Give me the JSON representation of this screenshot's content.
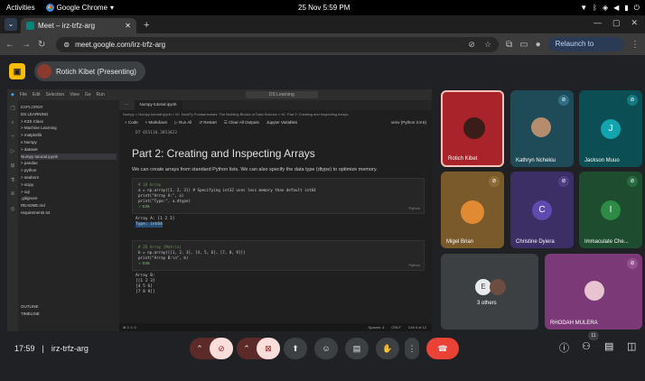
{
  "system": {
    "activities": "Activities",
    "app": "Google Chrome",
    "app_arrow": "▾",
    "datetime": "25 Nov  5:59 PM"
  },
  "browser": {
    "tab_title": "Meet – irz-trfz-arg",
    "tab_close": "✕",
    "new_tab": "+",
    "url": "meet.google.com/irz-trfz-arg",
    "relaunch": "Relaunch to update"
  },
  "meet": {
    "presenter": "Rotich Kibet (Presenting)",
    "call_time": "17:59",
    "separator": "|",
    "meeting_code": "irz-trfz-arg",
    "participant_count": "11",
    "tiles": [
      {
        "name": "Rotich Kibet",
        "color": "#a8232a"
      },
      {
        "name": "Kathryn Nchekiu",
        "color": "#1f4a57"
      },
      {
        "name": "Jackson Muuo",
        "initial": "J",
        "color": "#0b4f55",
        "avatar_color": "#12a4af"
      },
      {
        "name": "Migel Brian",
        "color": "#7a5a2a"
      },
      {
        "name": "Christine Dyiera",
        "initial": "C",
        "color": "#3b2f66",
        "avatar_color": "#5e4bb0"
      },
      {
        "name": "Immaculate Che...",
        "initial": "I",
        "color": "#1e4c2e",
        "avatar_color": "#2e8b46"
      },
      {
        "name": "3 others",
        "initial": "E",
        "color": "#3c4043"
      },
      {
        "name": "RHODAH MULERA",
        "color": "#7b3a77"
      }
    ]
  },
  "vscode": {
    "menu": [
      "File",
      "Edit",
      "Selection",
      "View",
      "Go",
      "Run"
    ],
    "search": "DS Learning",
    "explorer_header": "EXPLORER",
    "explorer_items": [
      "DS LEARNING",
      "> K3S Class",
      "> Machine Learning",
      "> matplotlib",
      "v Numpy",
      "  > dataset",
      "  Numpy tutorial.ipynb",
      "> pandas",
      "> python",
      "> seaborn",
      "> scipy",
      "> sql",
      "  .gitignore",
      "  README.md",
      "  requirements.txt"
    ],
    "outline": "OUTLINE",
    "timeline": "TIMELINE",
    "tab_active": "Numpy tutorial.ipynb",
    "breadcrumb": "Numpy > Numpy tutorial.ipynb > M↓ NumPy Fundamentals: The Building Blocks of Data Science > M↓ Part 2: Creating and Inspecting Arrays",
    "nb_toolbar": [
      "+ Code",
      "+ Markdown",
      "▷ Run All",
      "↺ Restart",
      "☰ Clear All Outputs",
      "Jupyter Variables",
      "venv (Python 3.9.6)"
    ],
    "prev_output": "DT 055118.3853822",
    "heading": "Part 2: Creating and Inspecting Arrays",
    "paragraph": "We can create arrays from standard Python lists. We can also specify the data type (dtype) to optimize memory.",
    "cell1": [
      "# 1D Array",
      "a = np.array([1, 2, 3]) # Specifying int32 uses less memory than default int64",
      "print(\"Array A:\", a)",
      "print(\"Type:\", a.dtype)"
    ],
    "cell1_run": "✓  0.0s",
    "cell_lang": "Python",
    "out1": [
      "Array A: [1 2 3]",
      "Type: int64"
    ],
    "cell2": [
      "# 2D Array (Matrix)",
      "b = np.array([[1, 2, 3], [4, 5, 6], [7, 8, 9]])",
      "print(\"Array B:\\n\", b)"
    ],
    "cell2_run": "✓  0.0s",
    "out2": [
      "Array B:",
      " [[1 2 3]",
      " [4 5 6]",
      " [7 8 9]]"
    ],
    "status": [
      "⊗ 0 ⚠ 0",
      "Spaces: 4",
      "CRLF",
      "Cell 4 of 12"
    ]
  }
}
